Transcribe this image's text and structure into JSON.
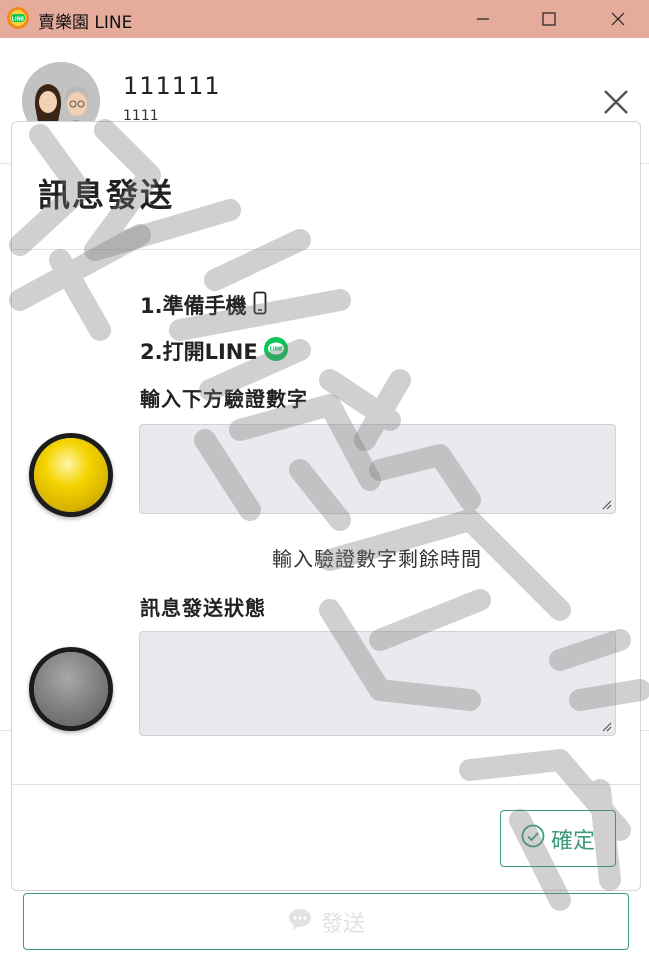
{
  "window": {
    "title": "賣樂園 LINE",
    "controls": [
      "minimize",
      "maximize",
      "close"
    ]
  },
  "profile": {
    "name": "111111",
    "id": "1111"
  },
  "modal": {
    "title": "訊息發送",
    "step1": "1.準備手機",
    "step2": "2.打開LINE",
    "verify_label": "輸入下方驗證數字",
    "verify_value": "",
    "timer_label": "輸入驗證數字剩餘時間",
    "status_label": "訊息發送狀態",
    "status_value": "",
    "confirm_label": "確定"
  },
  "footer": {
    "send_label": "發送"
  },
  "indicators": {
    "verify_led": "yellow",
    "status_led": "gray"
  },
  "colors": {
    "titlebar": "#e5ab9b",
    "accent": "#3c9b7b",
    "line_green": "#06c755",
    "textbox": "#e8eaed"
  },
  "icons": {
    "app": "line-badge-icon",
    "phone": "phone-icon",
    "line": "line-logo-icon",
    "confirm": "check-circle-icon",
    "send": "chat-bubble-icon"
  }
}
